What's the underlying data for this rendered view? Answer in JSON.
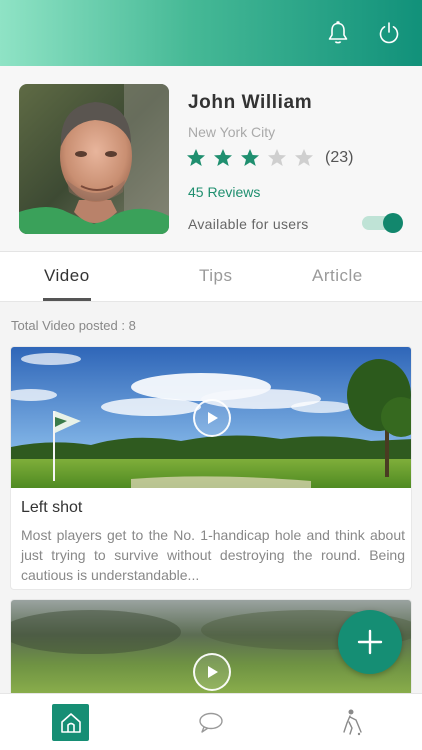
{
  "header": {
    "bell_icon": "bell-icon",
    "power_icon": "power-icon"
  },
  "profile": {
    "name": "John William",
    "city": "New York City",
    "rating": 3,
    "max_rating": 5,
    "rating_count": "(23)",
    "reviews": "45 Reviews",
    "availability_label": "Available for users",
    "available": true
  },
  "tabs": [
    {
      "label": "Video",
      "active": true
    },
    {
      "label": "Tips",
      "active": false
    },
    {
      "label": "Article",
      "active": false
    }
  ],
  "content": {
    "total_label": "Total Video posted : 8",
    "cards": [
      {
        "title": "Left shot",
        "description": "Most players get to the No. 1-handicap hole and think about just trying to survive without destroying the round. Being cautious is understandable..."
      },
      {
        "title": "",
        "description": ""
      }
    ]
  },
  "fab": {
    "icon": "plus-icon"
  },
  "bottom_nav": [
    {
      "icon": "home-icon",
      "active": true
    },
    {
      "icon": "chat-icon",
      "active": false
    },
    {
      "icon": "golfer-icon",
      "active": false
    }
  ],
  "colors": {
    "accent": "#168e74",
    "header_start": "#8fe3c5",
    "header_end": "#11917a",
    "star_filled": "#1f8f6f",
    "star_empty": "#cfcfcf"
  }
}
